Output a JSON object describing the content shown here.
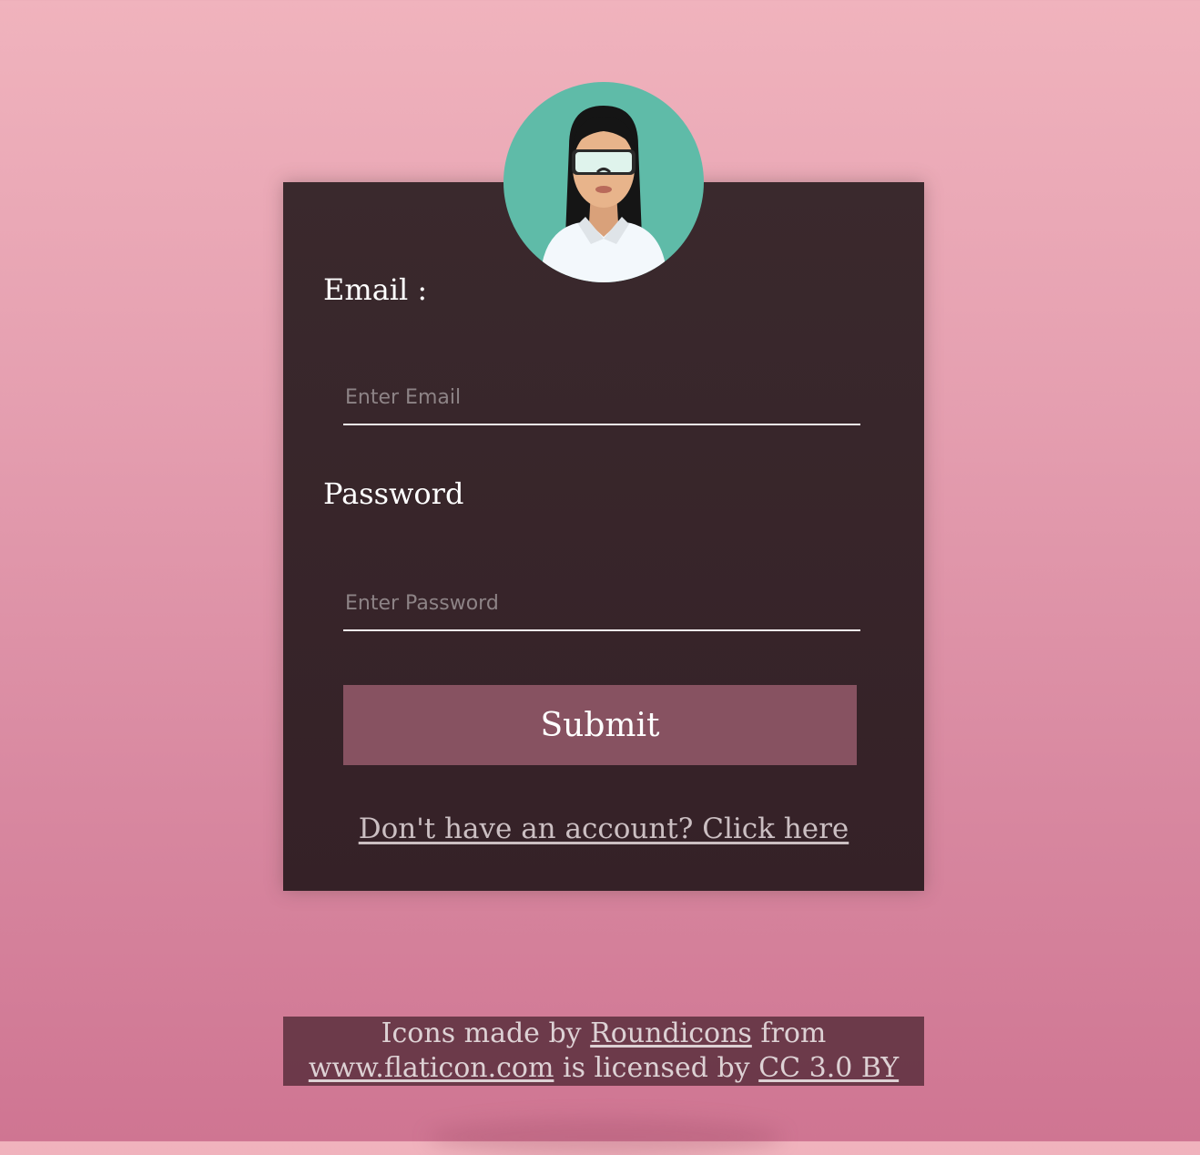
{
  "form": {
    "email_label": "Email :",
    "email_placeholder": "Enter Email",
    "email_value": "",
    "password_label": "Password",
    "password_placeholder": "Enter Password",
    "password_value": "",
    "submit_label": "Submit",
    "signup_link": "Don't have an account? Click here"
  },
  "avatar": {
    "icon": "woman-scientist-avatar-icon"
  },
  "credit": {
    "prefix": "Icons made by",
    "author": "Roundicons",
    "from": "from",
    "site": "www.flaticon.com",
    "licensed": "is licensed by",
    "license": "CC 3.0 BY"
  },
  "colors": {
    "background_top": "#f0b3bd",
    "background_bottom": "#cf7592",
    "card": "#38252a",
    "button": "#875261",
    "avatar_bg": "#5fbba8"
  }
}
